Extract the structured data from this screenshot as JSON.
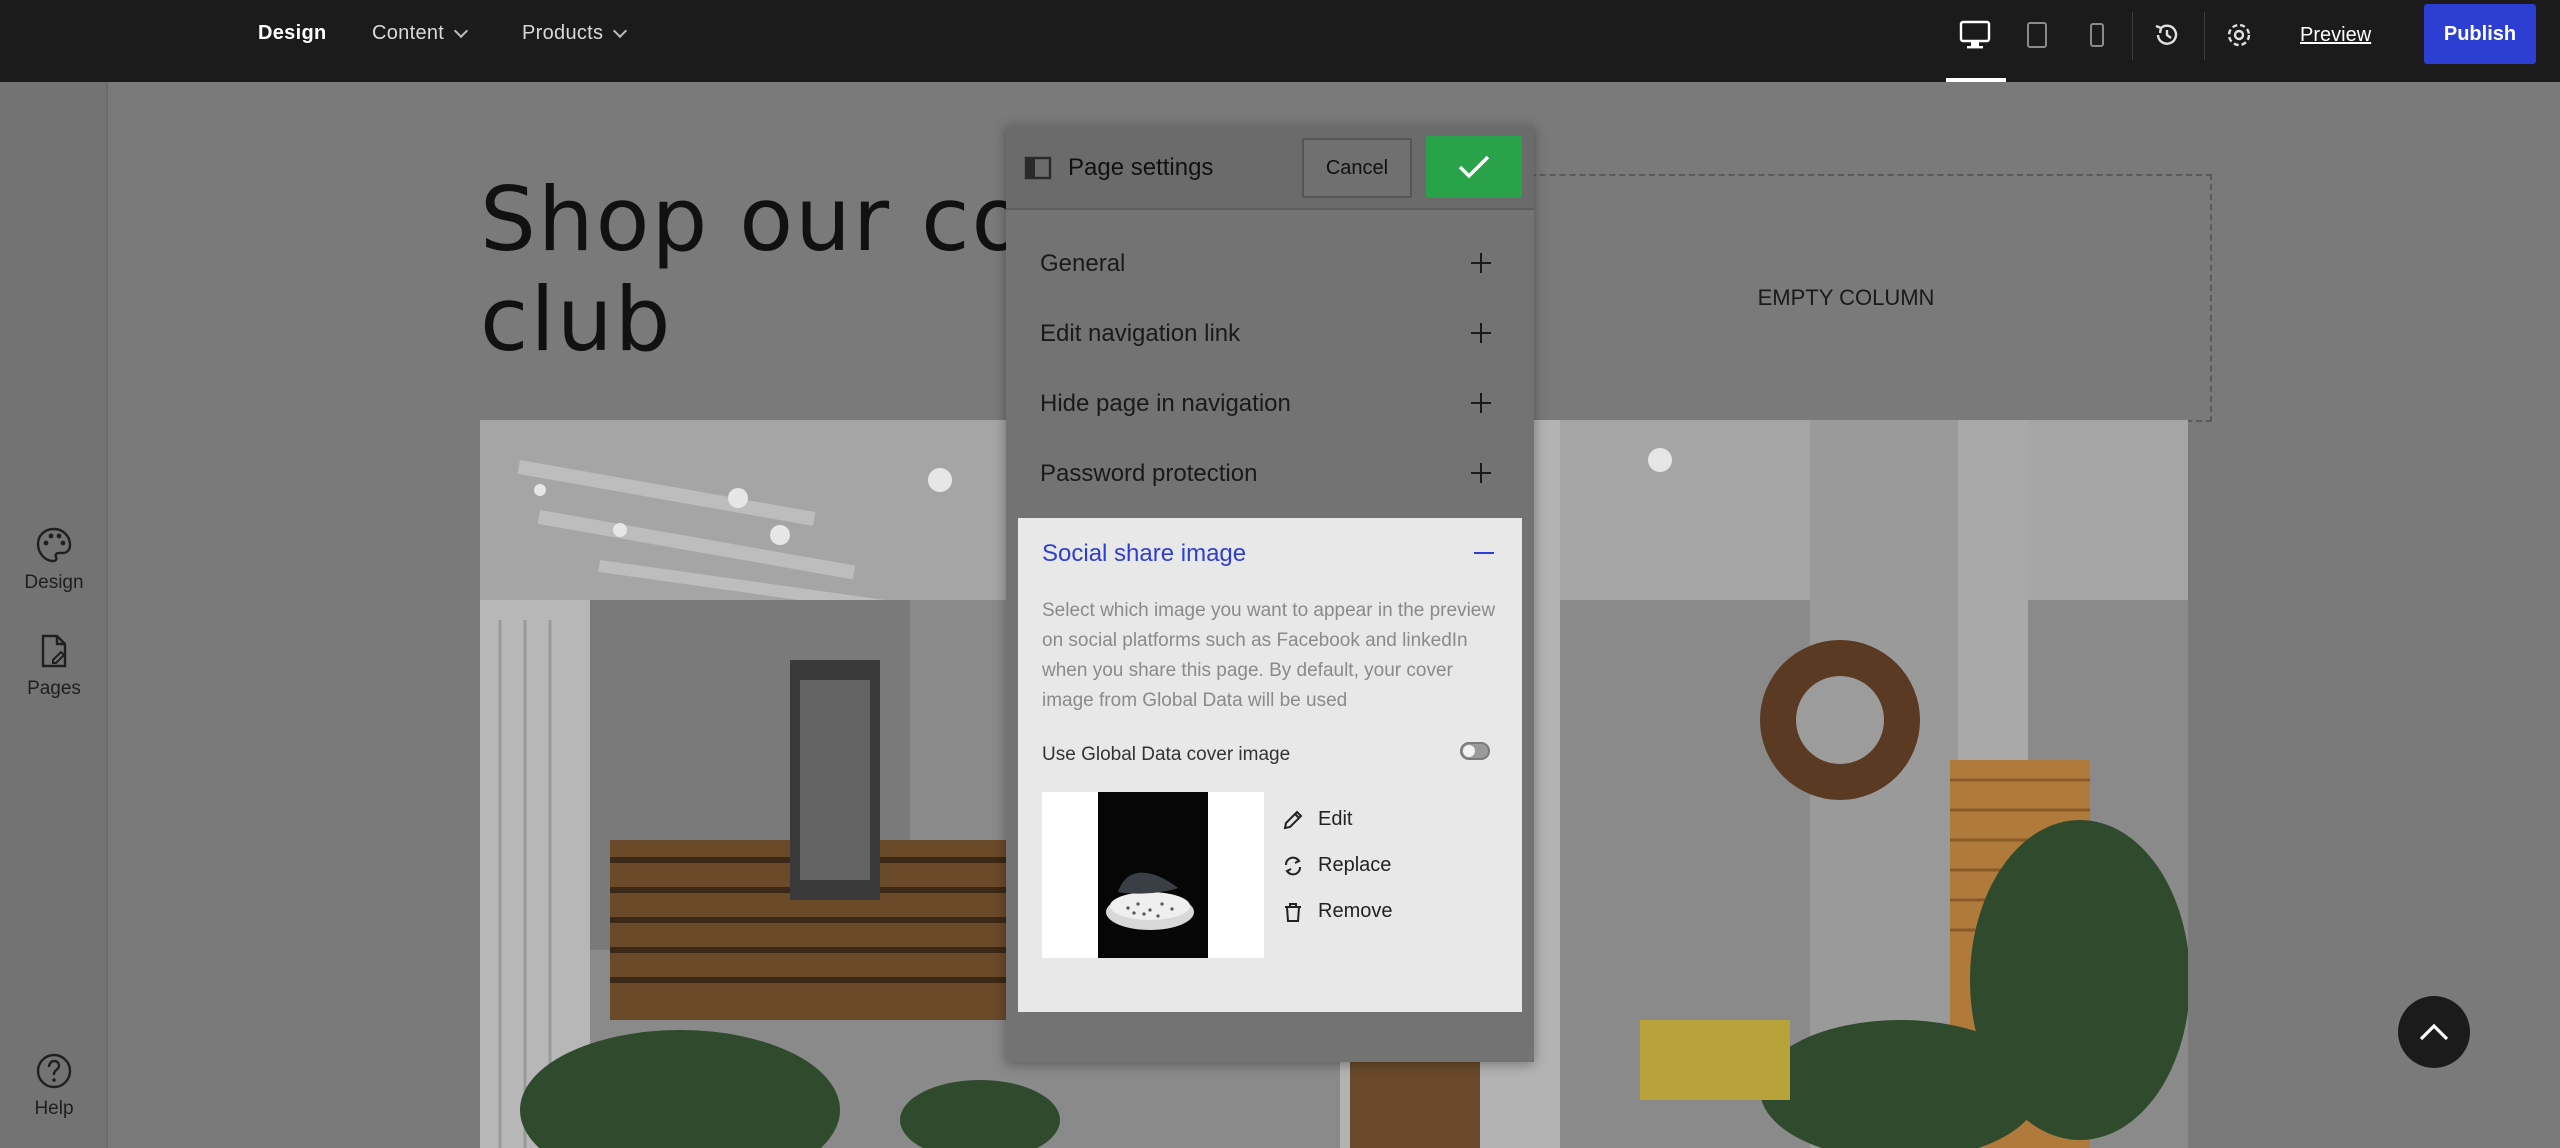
{
  "topbar": {
    "nav": [
      {
        "label": "Design"
      },
      {
        "label": "Content"
      },
      {
        "label": "Products"
      }
    ],
    "preview_label": "Preview",
    "publish_label": "Publish",
    "icons": [
      "desktop-icon",
      "tablet-icon",
      "mobile-icon",
      "history-icon",
      "settings-icon"
    ]
  },
  "leftrail": {
    "design_label": "Design",
    "pages_label": "Pages",
    "help_label": "Help"
  },
  "canvas": {
    "heading_line1": "Shop our cof",
    "heading_line2": "club",
    "empty_column": "EMPTY COLUMN"
  },
  "modal": {
    "title": "Page settings",
    "cancel_label": "Cancel",
    "sections": [
      {
        "label": "General"
      },
      {
        "label": "Edit navigation link"
      },
      {
        "label": "Hide page in navigation"
      },
      {
        "label": "Password protection"
      },
      {
        "label": "Social share image"
      }
    ],
    "social": {
      "description": "Select which image you want to appear in the preview on social platforms such as Facebook and linkedIn when you share this page. By default, your cover image from Global Data will be used",
      "toggle_label": "Use Global Data cover image",
      "toggle_on": false,
      "actions": [
        {
          "label": "Edit"
        },
        {
          "label": "Replace"
        },
        {
          "label": "Remove"
        }
      ]
    }
  },
  "colors": {
    "topbar": "#1b1b1b",
    "accent_blue": "#2c3fd2",
    "confirm_green": "#2aa24a"
  }
}
